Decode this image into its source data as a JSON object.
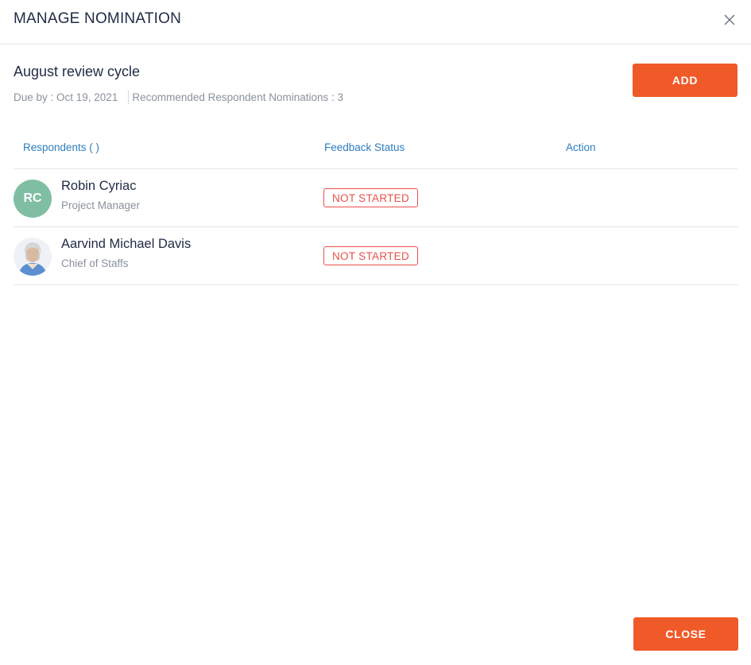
{
  "modal": {
    "title": "MANAGE NOMINATION",
    "close_icon": "close-icon"
  },
  "cycle": {
    "name": "August review cycle",
    "due_by": "Due by : Oct 19, 2021",
    "recommended": "Recommended Respondent Nominations : 3",
    "add_label": "ADD"
  },
  "table": {
    "headers": {
      "respondents": "Respondents ( )",
      "status": "Feedback Status",
      "action": "Action"
    },
    "rows": [
      {
        "initials": "RC",
        "name": "Robin Cyriac",
        "role": "Project Manager",
        "status": "NOT STARTED",
        "avatar_color": "#7fbea3"
      },
      {
        "initials": "",
        "name": "Aarvind Michael Davis",
        "role": "Chief of Staffs",
        "status": "NOT STARTED",
        "avatar_icon": "user-photo"
      }
    ]
  },
  "footer": {
    "close_label": "CLOSE"
  },
  "colors": {
    "accent": "#f05a28",
    "header_link": "#2e7ebf",
    "status_red": "#e8504a",
    "text_dark": "#1f2a44",
    "text_muted": "#8a919c"
  }
}
